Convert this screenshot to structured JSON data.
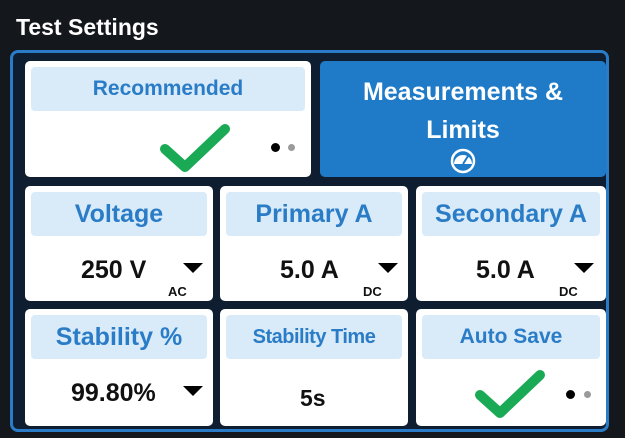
{
  "window": {
    "title": "Test Settings"
  },
  "cards": {
    "recommended": {
      "label": "Recommended",
      "checked": true,
      "page": 1,
      "pages": 2
    },
    "measurements": {
      "label_line1": "Measurements &",
      "label_line2": "Limits",
      "icon": "gauge-icon"
    },
    "voltage": {
      "label": "Voltage",
      "value": "250 V",
      "unit": "AC"
    },
    "primary": {
      "label": "Primary A",
      "value": "5.0 A",
      "unit": "DC"
    },
    "secondary": {
      "label": "Secondary A",
      "value": "5.0 A",
      "unit": "DC"
    },
    "stability_pct": {
      "label": "Stability %",
      "value": "99.80%"
    },
    "stability_time": {
      "label": "Stability Time",
      "value": "5s"
    },
    "auto_save": {
      "label": "Auto Save",
      "checked": true,
      "page": 1,
      "pages": 2
    }
  },
  "colors": {
    "accent": "#1f7bc7",
    "label_bg": "#d9ebf9",
    "label_text": "#2b7cc7",
    "check": "#1aaa55",
    "frame": "#2a7cc8",
    "background": "#14171c"
  }
}
